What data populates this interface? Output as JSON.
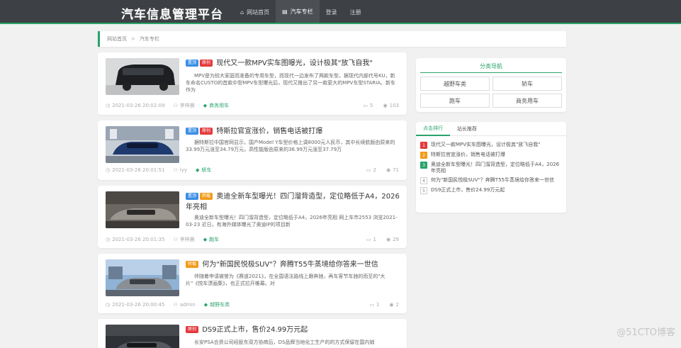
{
  "site": {
    "brand": "汽车信息管理平台"
  },
  "nav": [
    {
      "label": "网站首页",
      "icon": "home-icon",
      "glyph": "⌂",
      "active": false
    },
    {
      "label": "汽车专栏",
      "icon": "document-icon",
      "glyph": "▤",
      "active": true
    },
    {
      "label": "登录",
      "icon": "",
      "glyph": "",
      "active": false
    },
    {
      "label": "注册",
      "icon": "",
      "glyph": "",
      "active": false
    }
  ],
  "breadcrumb": {
    "home": "网站首页",
    "separator": ">",
    "current": "汽车专栏"
  },
  "articles": [
    {
      "tags": [
        {
          "text": "置顶",
          "color": "blue"
        },
        {
          "text": "原创",
          "color": "red"
        }
      ],
      "title": "现代又一款MPV实车图曝光，设计极其\"放飞自我\"",
      "summary": "MPV是为较大家庭而准备的专用车型，而现代一边发布了两款车型，据现代内部代号KU，新车命名CUSTO的首款中型MPV车型曝光后，现代又推出了另一款更大的MPV车型STARIA。新车作为",
      "date": "2021-03-26 20:02:09",
      "author": "李梓晨",
      "category": "商务用车",
      "comments": "5",
      "views": "103"
    },
    {
      "tags": [
        {
          "text": "置顶",
          "color": "blue"
        },
        {
          "text": "原创",
          "color": "red"
        }
      ],
      "title": "特斯拉官宣涨价，销售电话被打爆",
      "summary": "据特斯拉中国官网显示，国产Model Y车型价格上调8000元人民币，其中长续航版由原来的33.99万元涨至34.79万元，高性能版由原来的36.99万元涨至37.79万",
      "date": "2021-03-26 20:01:51",
      "author": "lyy",
      "category": "轿车",
      "comments": "2",
      "views": "71"
    },
    {
      "tags": [
        {
          "text": "置顶",
          "color": "blue"
        },
        {
          "text": "转载",
          "color": "orange"
        }
      ],
      "title": "奥迪全新车型曝光！四门溜背造型，定位略低于A4，2026年亮相",
      "summary": "奥迪全新车型曝光！四门溜背造型，定位略低于A4，2026年亮相 网上车市2553 浏览2021-03-23 近日，有海外媒体曝光了奥迪IP的项目新",
      "date": "2021-03-26 20:01:35",
      "author": "李梓晨",
      "category": "跑车",
      "comments": "1",
      "views": "29"
    },
    {
      "tags": [
        {
          "text": "转载",
          "color": "orange"
        }
      ],
      "title": "何为\"新国民悦极SUV\"？奔腾T55牛蒸境给你答来一世信",
      "summary": "伴随着申请被誉为《赛道2021》，在全国语法路线上跟奔驰，再车客节车驰的而至的\"大片\"《悦车漂画集》，也正式拉开帷幕。对",
      "date": "2021-03-26 20:00:45",
      "author": "admin",
      "category": "越野车类",
      "comments": "1",
      "views": "2"
    },
    {
      "tags": [
        {
          "text": "原创",
          "color": "red"
        }
      ],
      "title": "DS9正式上市，售价24.99万元起",
      "summary": "长安PSA合资公司经股东双方协商后，DS品牌当地化工生产的的方式保留在国内销",
      "date": "",
      "author": "",
      "category": "",
      "comments": "",
      "views": ""
    }
  ],
  "sidebar": {
    "category_nav": {
      "title": "分类导航",
      "items": [
        "越野车类",
        "轿车",
        "跑车",
        "商务用车"
      ]
    },
    "tabs": [
      "点击排行",
      "站长推荐"
    ],
    "ranking": [
      {
        "num": "1",
        "text": "现代又一款MPV实车图曝光，设计极其\"放飞自我\""
      },
      {
        "num": "2",
        "text": "特斯拉官宣涨价，销售电话被打爆"
      },
      {
        "num": "3",
        "text": "奥迪全新车型曝光！四门溜背造型，定位略低于A4，2026年亮相"
      },
      {
        "num": "4",
        "text": "何为\"新国民悦极SUV\"？奔腾T55牛蒸境给你答来一世信"
      },
      {
        "num": "5",
        "text": "DS9正式上市，售价24.99万元起"
      }
    ]
  },
  "watermark": "@51CTO博客"
}
